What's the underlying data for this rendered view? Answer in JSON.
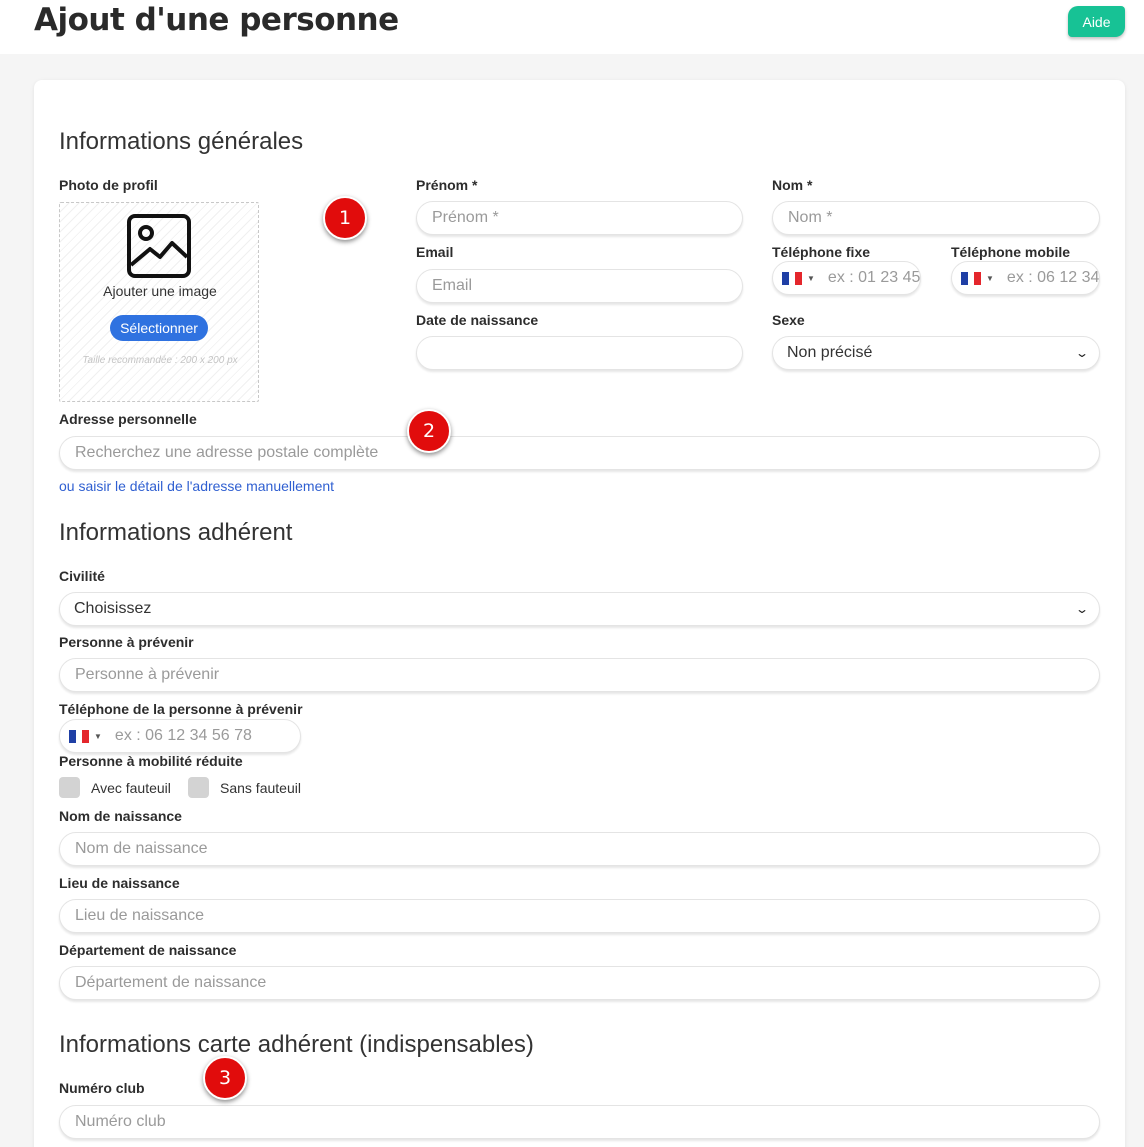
{
  "header": {
    "title": "Ajout d'une personne",
    "help_label": "Aide"
  },
  "general": {
    "title": "Informations générales",
    "photo": {
      "label": "Photo de profil",
      "add_text": "Ajouter une image",
      "select_label": "Sélectionner",
      "hint": "Taille recommandée : 200 x 200 px"
    },
    "first_name": {
      "label": "Prénom *",
      "placeholder": "Prénom *"
    },
    "last_name": {
      "label": "Nom *",
      "placeholder": "Nom *"
    },
    "email": {
      "label": "Email",
      "placeholder": "Email"
    },
    "landline": {
      "label": "Téléphone fixe",
      "placeholder": "ex : 01 23 45"
    },
    "mobile": {
      "label": "Téléphone mobile",
      "placeholder": "ex : 06 12 34"
    },
    "birth_date": {
      "label": "Date de naissance",
      "value": ""
    },
    "sex": {
      "label": "Sexe",
      "value": "Non précisé"
    },
    "address": {
      "label": "Adresse personnelle",
      "placeholder": "Recherchez une adresse postale complète",
      "manual_link": "ou saisir le détail de l'adresse manuellement"
    }
  },
  "member": {
    "title": "Informations adhérent",
    "civility": {
      "label": "Civilité",
      "value": "Choisissez"
    },
    "contact_person": {
      "label": "Personne à prévenir",
      "placeholder": "Personne à prévenir"
    },
    "contact_phone": {
      "label": "Téléphone de la personne à prévenir",
      "placeholder": "ex : 06 12 34 56 78"
    },
    "reduced_mobility": {
      "label": "Personne à mobilité réduite",
      "option_with": "Avec fauteuil",
      "option_without": "Sans fauteuil"
    },
    "birth_name": {
      "label": "Nom de naissance",
      "placeholder": "Nom de naissance"
    },
    "birth_place": {
      "label": "Lieu de naissance",
      "placeholder": "Lieu de naissance"
    },
    "birth_department": {
      "label": "Département de naissance",
      "placeholder": "Département de naissance"
    }
  },
  "card": {
    "title": "Informations carte adhérent (indispensables)",
    "club_number": {
      "label": "Numéro club",
      "placeholder": "Numéro club"
    }
  },
  "annotations": [
    "1",
    "2",
    "3"
  ],
  "colors": {
    "help_button": "#17c295",
    "select_button": "#2f72e0",
    "link": "#2f5fd1",
    "badge": "#e10c0c",
    "flag_blue": "#1f3fa5",
    "flag_white": "#ffffff",
    "flag_red": "#e4262c"
  },
  "icons": {
    "photo": "image-icon",
    "dropdown": "chevron-down-icon",
    "flag": "france-flag-icon"
  }
}
